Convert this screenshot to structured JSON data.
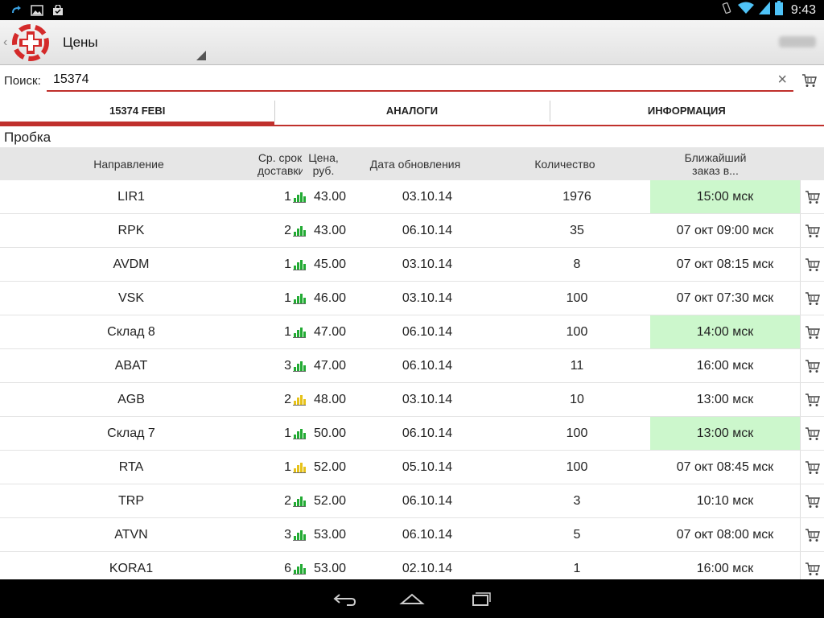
{
  "status_bar": {
    "time": "9:43"
  },
  "action_bar": {
    "title": "Цены"
  },
  "search": {
    "label": "Поиск:",
    "value": "15374",
    "clear_glyph": "×"
  },
  "tabs": [
    {
      "label": "15374 FEBI",
      "active": true
    },
    {
      "label": "АНАЛОГИ",
      "active": false
    },
    {
      "label": "ИНФОРМАЦИЯ",
      "active": false
    }
  ],
  "section_title": "Пробка",
  "columns": {
    "direction": "Направление",
    "term": "Ср. срок доставки",
    "price": "Цена, руб.",
    "date": "Дата обновления",
    "qty": "Количество",
    "nearest": "Ближайший заказ в..."
  },
  "colors": {
    "accent": "#c0302c",
    "highlight": "#ccf7cc",
    "bar_green": "#22aa33",
    "bar_yellow": "#e6c21a"
  },
  "rows": [
    {
      "direction": "LIR1",
      "term": "1",
      "bars": "green",
      "price": "43.00",
      "date": "03.10.14",
      "qty": "1976",
      "nearest": "15:00 мск",
      "highlight": true
    },
    {
      "direction": "RPK",
      "term": "2",
      "bars": "green",
      "price": "43.00",
      "date": "06.10.14",
      "qty": "35",
      "nearest": "07 окт 09:00 мск",
      "highlight": false
    },
    {
      "direction": "AVDM",
      "term": "1",
      "bars": "green",
      "price": "45.00",
      "date": "03.10.14",
      "qty": "8",
      "nearest": "07 окт 08:15 мск",
      "highlight": false
    },
    {
      "direction": "VSK",
      "term": "1",
      "bars": "green",
      "price": "46.00",
      "date": "03.10.14",
      "qty": "100",
      "nearest": "07 окт 07:30 мск",
      "highlight": false
    },
    {
      "direction": "Склад 8",
      "term": "1",
      "bars": "green",
      "price": "47.00",
      "date": "06.10.14",
      "qty": "100",
      "nearest": "14:00 мск",
      "highlight": true
    },
    {
      "direction": "ABAT",
      "term": "3",
      "bars": "green",
      "price": "47.00",
      "date": "06.10.14",
      "qty": "11",
      "nearest": "16:00 мск",
      "highlight": false
    },
    {
      "direction": "AGB",
      "term": "2",
      "bars": "yellow",
      "price": "48.00",
      "date": "03.10.14",
      "qty": "10",
      "nearest": "13:00 мск",
      "highlight": false
    },
    {
      "direction": "Склад 7",
      "term": "1",
      "bars": "green",
      "price": "50.00",
      "date": "06.10.14",
      "qty": "100",
      "nearest": "13:00 мск",
      "highlight": true
    },
    {
      "direction": "RTA",
      "term": "1",
      "bars": "yellow",
      "price": "52.00",
      "date": "05.10.14",
      "qty": "100",
      "nearest": "07 окт 08:45 мск",
      "highlight": false
    },
    {
      "direction": "TRP",
      "term": "2",
      "bars": "green",
      "price": "52.00",
      "date": "06.10.14",
      "qty": "3",
      "nearest": "10:10 мск",
      "highlight": false
    },
    {
      "direction": "ATVN",
      "term": "3",
      "bars": "green",
      "price": "53.00",
      "date": "06.10.14",
      "qty": "5",
      "nearest": "07 окт 08:00 мск",
      "highlight": false
    },
    {
      "direction": "KORA1",
      "term": "6",
      "bars": "green",
      "price": "53.00",
      "date": "02.10.14",
      "qty": "1",
      "nearest": "16:00 мск",
      "highlight": false
    }
  ]
}
